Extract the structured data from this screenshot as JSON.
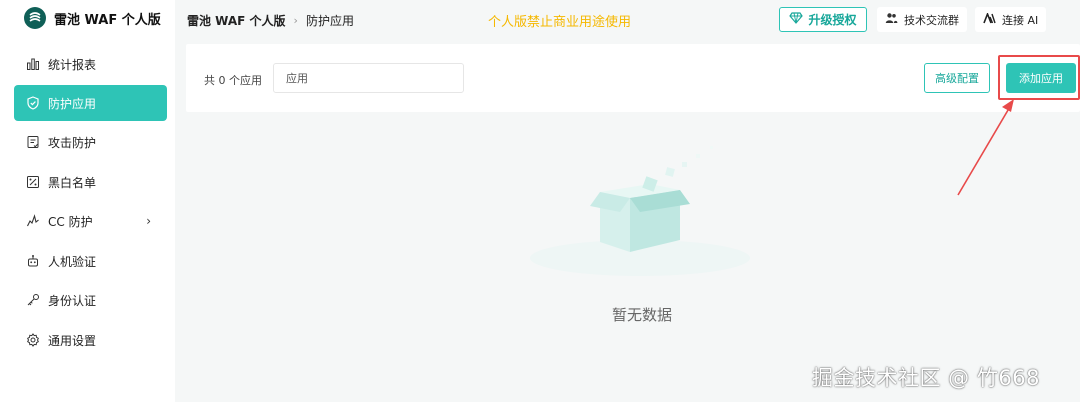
{
  "app": {
    "name": "雷池 WAF 个人版"
  },
  "sidebar": {
    "items": [
      {
        "label": "统计报表",
        "icon": "bar-chart-icon"
      },
      {
        "label": "防护应用",
        "icon": "shield-icon",
        "active": true
      },
      {
        "label": "攻击防护",
        "icon": "document-icon"
      },
      {
        "label": "黑白名单",
        "icon": "list-check-icon"
      },
      {
        "label": "CC 防护",
        "icon": "chart-spike-icon",
        "has_children": true
      },
      {
        "label": "人机验证",
        "icon": "robot-icon"
      },
      {
        "label": "身份认证",
        "icon": "key-icon"
      },
      {
        "label": "通用设置",
        "icon": "gear-icon"
      }
    ],
    "chevron": "›"
  },
  "header": {
    "breadcrumb": [
      "雷池 WAF 个人版",
      "防护应用"
    ],
    "separator": "›",
    "notice": "个人版禁止商业用途使用",
    "upgrade_label": "升级授权",
    "community_label": "技术交流群",
    "ai_label": "连接 AI"
  },
  "toolbar": {
    "count_label": "共 0 个应用",
    "search_placeholder": "应用",
    "search_value": "",
    "advanced_label": "高级配置",
    "add_label": "添加应用"
  },
  "empty_state": {
    "text": "暂无数据"
  },
  "watermark": "掘金技术社区 @ 竹668",
  "colors": {
    "accent": "#2ec4b6",
    "notice": "#f5b800",
    "highlight": "#e84a4a"
  }
}
